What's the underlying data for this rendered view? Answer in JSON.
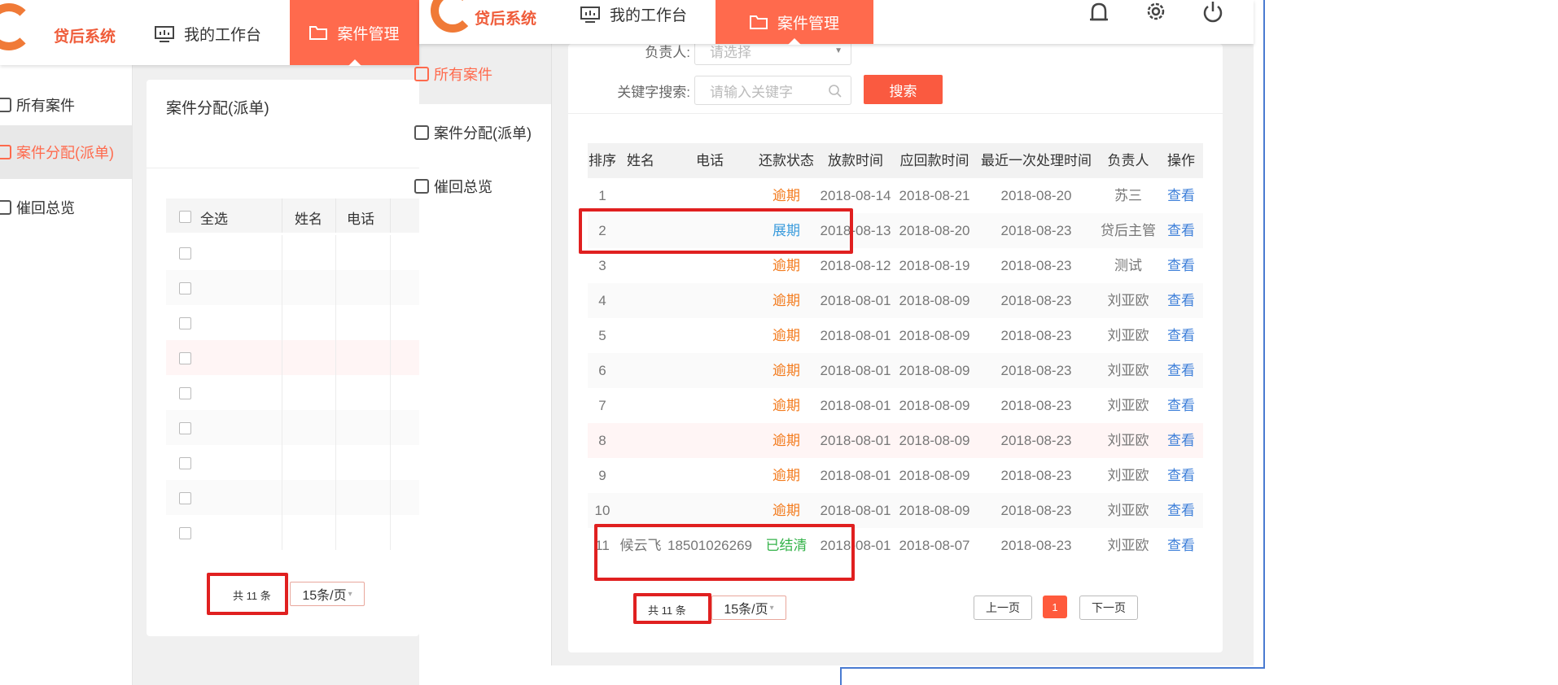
{
  "left": {
    "header": {
      "brand": "贷后系统",
      "nav_workbench": "我的工作台",
      "nav_cases": "案件管理"
    },
    "sidebar": {
      "items": [
        {
          "label": "所有案件"
        },
        {
          "label": "案件分配(派单)"
        },
        {
          "label": "催回总览"
        }
      ]
    },
    "panel_title": "案件分配(派单)",
    "table": {
      "headers": {
        "select_all": "全选",
        "name": "姓名",
        "phone": "电话"
      }
    },
    "pagination": {
      "total": "共 11 条",
      "page_size": "15条/页"
    }
  },
  "right": {
    "header": {
      "brand": "贷后系统",
      "nav_workbench": "我的工作台",
      "nav_cases": "案件管理"
    },
    "sidebar": {
      "items": [
        {
          "label": "所有案件"
        },
        {
          "label": "案件分配(派单)"
        },
        {
          "label": "催回总览"
        }
      ]
    },
    "filters": {
      "owner_label": "负责人:",
      "owner_placeholder": "请选择",
      "keyword_label": "关键字搜索:",
      "keyword_placeholder": "请输入关键字",
      "search_button": "搜索"
    },
    "table": {
      "headers": [
        "排序",
        "姓名",
        "电话",
        "还款状态",
        "放款时间",
        "应回款时间",
        "最近一次处理时间",
        "负责人",
        "操作"
      ],
      "rows": [
        {
          "no": "1",
          "name": "",
          "phone": "",
          "status": "逾期",
          "status_type": "overdue",
          "loan": "2018-08-14",
          "due": "2018-08-21",
          "last": "2018-08-20",
          "owner": "苏三",
          "op": "查看"
        },
        {
          "no": "2",
          "name": "",
          "phone": "",
          "status": "展期",
          "status_type": "ext",
          "loan": "2018-08-13",
          "due": "2018-08-20",
          "last": "2018-08-23",
          "owner": "贷后主管",
          "op": "查看"
        },
        {
          "no": "3",
          "name": "",
          "phone": "",
          "status": "逾期",
          "status_type": "overdue",
          "loan": "2018-08-12",
          "due": "2018-08-19",
          "last": "2018-08-23",
          "owner": "测试",
          "op": "查看"
        },
        {
          "no": "4",
          "name": "",
          "phone": "",
          "status": "逾期",
          "status_type": "overdue",
          "loan": "2018-08-01",
          "due": "2018-08-09",
          "last": "2018-08-23",
          "owner": "刘亚欧",
          "op": "查看"
        },
        {
          "no": "5",
          "name": "",
          "phone": "",
          "status": "逾期",
          "status_type": "overdue",
          "loan": "2018-08-01",
          "due": "2018-08-09",
          "last": "2018-08-23",
          "owner": "刘亚欧",
          "op": "查看"
        },
        {
          "no": "6",
          "name": "",
          "phone": "",
          "status": "逾期",
          "status_type": "overdue",
          "loan": "2018-08-01",
          "due": "2018-08-09",
          "last": "2018-08-23",
          "owner": "刘亚欧",
          "op": "查看"
        },
        {
          "no": "7",
          "name": "",
          "phone": "",
          "status": "逾期",
          "status_type": "overdue",
          "loan": "2018-08-01",
          "due": "2018-08-09",
          "last": "2018-08-23",
          "owner": "刘亚欧",
          "op": "查看"
        },
        {
          "no": "8",
          "name": "",
          "phone": "",
          "status": "逾期",
          "status_type": "overdue",
          "loan": "2018-08-01",
          "due": "2018-08-09",
          "last": "2018-08-23",
          "owner": "刘亚欧",
          "op": "查看"
        },
        {
          "no": "9",
          "name": "",
          "phone": "",
          "status": "逾期",
          "status_type": "overdue",
          "loan": "2018-08-01",
          "due": "2018-08-09",
          "last": "2018-08-23",
          "owner": "刘亚欧",
          "op": "查看"
        },
        {
          "no": "10",
          "name": "",
          "phone": "",
          "status": "逾期",
          "status_type": "overdue",
          "loan": "2018-08-01",
          "due": "2018-08-09",
          "last": "2018-08-23",
          "owner": "刘亚欧",
          "op": "查看"
        },
        {
          "no": "11",
          "name": "候云飞",
          "phone": "18501026269",
          "status": "已结清",
          "status_type": "done",
          "loan": "2018-08-01",
          "due": "2018-08-07",
          "last": "2018-08-23",
          "owner": "刘亚欧",
          "op": "查看"
        }
      ]
    },
    "pagination": {
      "total": "共 11 条",
      "page_size": "15条/页",
      "prev": "上一页",
      "current": "1",
      "next": "下一页"
    }
  },
  "colors": {
    "accent": "#ff6a4d",
    "highlight_box": "#e02020",
    "overdue": "#f37b1d",
    "extended": "#3a9bdc",
    "settled": "#35b34a",
    "link": "#3d7fd9"
  },
  "icons": [
    "logo-icon",
    "monitor-icon",
    "folder-icon",
    "bell-icon",
    "gear-icon",
    "power-icon",
    "search-icon",
    "chevron-down-icon"
  ]
}
